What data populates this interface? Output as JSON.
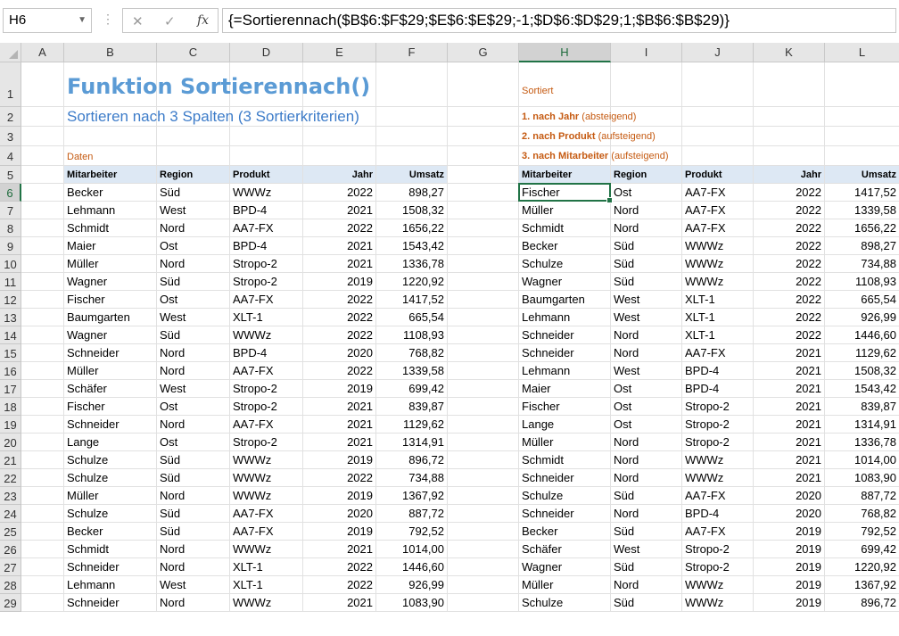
{
  "formula_bar": {
    "name_box": "H6",
    "formula": "{=Sortierennach($B$6:$F$29;$E$6:$E$29;-1;$D$6:$D$29;1;$B$6:$B$29)}"
  },
  "columns": [
    "A",
    "B",
    "C",
    "D",
    "E",
    "F",
    "G",
    "H",
    "I",
    "J",
    "K",
    "L"
  ],
  "rows": [
    "1",
    "2",
    "3",
    "4",
    "5",
    "6",
    "7",
    "8",
    "9",
    "10",
    "11",
    "12",
    "13",
    "14",
    "15",
    "16",
    "17",
    "18",
    "19",
    "20",
    "21",
    "22",
    "23",
    "24",
    "25",
    "26",
    "27",
    "28",
    "29"
  ],
  "selected_cell": "H6",
  "sheet": {
    "title": "Funktion Sortierennach()",
    "subtitle": "Sortieren nach 3 Spalten (3 Sortierkriterien)",
    "label_daten": "Daten",
    "label_sortiert": "Sortiert",
    "crit1": {
      "num": "1. nach ",
      "key": "Jahr",
      "rest": " (absteigend)"
    },
    "crit2": {
      "num": "2. nach ",
      "key": "Produkt",
      "rest": " (aufsteigend)"
    },
    "crit3": {
      "num": "3. nach ",
      "key": "Mitarbeiter",
      "rest": " (aufsteigend)"
    },
    "headers": [
      "Mitarbeiter",
      "Region",
      "Produkt",
      "Jahr",
      "Umsatz"
    ],
    "source": [
      [
        "Becker",
        "Süd",
        "WWWz",
        "2022",
        "898,27"
      ],
      [
        "Lehmann",
        "West",
        "BPD-4",
        "2021",
        "1508,32"
      ],
      [
        "Schmidt",
        "Nord",
        "AA7-FX",
        "2022",
        "1656,22"
      ],
      [
        "Maier",
        "Ost",
        "BPD-4",
        "2021",
        "1543,42"
      ],
      [
        "Müller",
        "Nord",
        "Stropo-2",
        "2021",
        "1336,78"
      ],
      [
        "Wagner",
        "Süd",
        "Stropo-2",
        "2019",
        "1220,92"
      ],
      [
        "Fischer",
        "Ost",
        "AA7-FX",
        "2022",
        "1417,52"
      ],
      [
        "Baumgarten",
        "West",
        "XLT-1",
        "2022",
        "665,54"
      ],
      [
        "Wagner",
        "Süd",
        "WWWz",
        "2022",
        "1108,93"
      ],
      [
        "Schneider",
        "Nord",
        "BPD-4",
        "2020",
        "768,82"
      ],
      [
        "Müller",
        "Nord",
        "AA7-FX",
        "2022",
        "1339,58"
      ],
      [
        "Schäfer",
        "West",
        "Stropo-2",
        "2019",
        "699,42"
      ],
      [
        "Fischer",
        "Ost",
        "Stropo-2",
        "2021",
        "839,87"
      ],
      [
        "Schneider",
        "Nord",
        "AA7-FX",
        "2021",
        "1129,62"
      ],
      [
        "Lange",
        "Ost",
        "Stropo-2",
        "2021",
        "1314,91"
      ],
      [
        "Schulze",
        "Süd",
        "WWWz",
        "2019",
        "896,72"
      ],
      [
        "Schulze",
        "Süd",
        "WWWz",
        "2022",
        "734,88"
      ],
      [
        "Müller",
        "Nord",
        "WWWz",
        "2019",
        "1367,92"
      ],
      [
        "Schulze",
        "Süd",
        "AA7-FX",
        "2020",
        "887,72"
      ],
      [
        "Becker",
        "Süd",
        "AA7-FX",
        "2019",
        "792,52"
      ],
      [
        "Schmidt",
        "Nord",
        "WWWz",
        "2021",
        "1014,00"
      ],
      [
        "Schneider",
        "Nord",
        "XLT-1",
        "2022",
        "1446,60"
      ],
      [
        "Lehmann",
        "West",
        "XLT-1",
        "2022",
        "926,99"
      ],
      [
        "Schneider",
        "Nord",
        "WWWz",
        "2021",
        "1083,90"
      ]
    ],
    "sorted": [
      [
        "Fischer",
        "Ost",
        "AA7-FX",
        "2022",
        "1417,52"
      ],
      [
        "Müller",
        "Nord",
        "AA7-FX",
        "2022",
        "1339,58"
      ],
      [
        "Schmidt",
        "Nord",
        "AA7-FX",
        "2022",
        "1656,22"
      ],
      [
        "Becker",
        "Süd",
        "WWWz",
        "2022",
        "898,27"
      ],
      [
        "Schulze",
        "Süd",
        "WWWz",
        "2022",
        "734,88"
      ],
      [
        "Wagner",
        "Süd",
        "WWWz",
        "2022",
        "1108,93"
      ],
      [
        "Baumgarten",
        "West",
        "XLT-1",
        "2022",
        "665,54"
      ],
      [
        "Lehmann",
        "West",
        "XLT-1",
        "2022",
        "926,99"
      ],
      [
        "Schneider",
        "Nord",
        "XLT-1",
        "2022",
        "1446,60"
      ],
      [
        "Schneider",
        "Nord",
        "AA7-FX",
        "2021",
        "1129,62"
      ],
      [
        "Lehmann",
        "West",
        "BPD-4",
        "2021",
        "1508,32"
      ],
      [
        "Maier",
        "Ost",
        "BPD-4",
        "2021",
        "1543,42"
      ],
      [
        "Fischer",
        "Ost",
        "Stropo-2",
        "2021",
        "839,87"
      ],
      [
        "Lange",
        "Ost",
        "Stropo-2",
        "2021",
        "1314,91"
      ],
      [
        "Müller",
        "Nord",
        "Stropo-2",
        "2021",
        "1336,78"
      ],
      [
        "Schmidt",
        "Nord",
        "WWWz",
        "2021",
        "1014,00"
      ],
      [
        "Schneider",
        "Nord",
        "WWWz",
        "2021",
        "1083,90"
      ],
      [
        "Schulze",
        "Süd",
        "AA7-FX",
        "2020",
        "887,72"
      ],
      [
        "Schneider",
        "Nord",
        "BPD-4",
        "2020",
        "768,82"
      ],
      [
        "Becker",
        "Süd",
        "AA7-FX",
        "2019",
        "792,52"
      ],
      [
        "Schäfer",
        "West",
        "Stropo-2",
        "2019",
        "699,42"
      ],
      [
        "Wagner",
        "Süd",
        "Stropo-2",
        "2019",
        "1220,92"
      ],
      [
        "Müller",
        "Nord",
        "WWWz",
        "2019",
        "1367,92"
      ],
      [
        "Schulze",
        "Süd",
        "WWWz",
        "2019",
        "896,72"
      ]
    ]
  }
}
